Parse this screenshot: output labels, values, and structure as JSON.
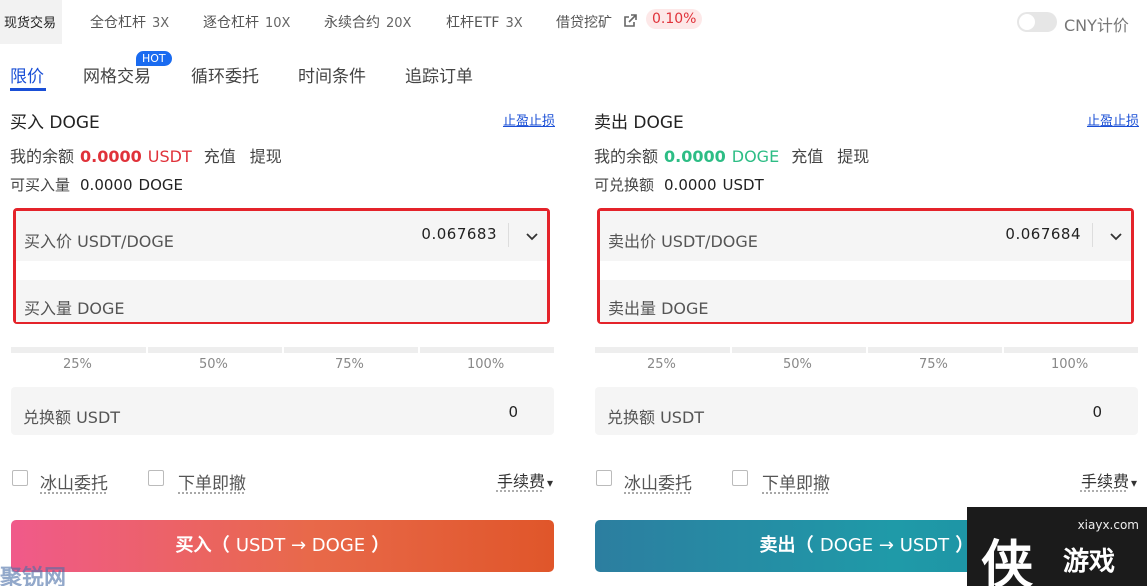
{
  "top_tabs": {
    "spot": "现货交易",
    "cross": "全仓杠杆",
    "cross_mult": "3X",
    "isolated": "逐仓杠杆",
    "isolated_mult": "10X",
    "perpetual": "永续合约",
    "perpetual_mult": "20X",
    "etf": "杠杆ETF",
    "etf_mult": "3X",
    "lending": "借贷挖矿",
    "lending_rate": "0.10%",
    "cny_label": "CNY计价"
  },
  "order_tabs": {
    "limit": "限价",
    "grid": "网格交易",
    "hot": "HOT",
    "loop": "循环委托",
    "time": "时间条件",
    "trailing": "追踪订单"
  },
  "buy": {
    "title": "买入 DOGE",
    "tpsl": "止盈止损",
    "balance_label": "我的余额",
    "balance_value": "0.0000",
    "balance_unit": "USDT",
    "deposit": "充值",
    "withdraw": "提现",
    "avail_label": "可买入量",
    "avail_value": "0.0000",
    "avail_unit": "DOGE",
    "price_label": "买入价 USDT/DOGE",
    "price_value": "0.067683",
    "amount_label": "买入量 DOGE",
    "pct": [
      "25%",
      "50%",
      "75%",
      "100%"
    ],
    "exchange_label": "兑换额 USDT",
    "exchange_value": "0",
    "iceberg": "冰山委托",
    "ioc": "下单即撤",
    "fee": "手续费",
    "action_main": "买入（",
    "action_pair": "USDT → DOGE",
    "action_end": "）"
  },
  "sell": {
    "title": "卖出 DOGE",
    "tpsl": "止盈止损",
    "balance_label": "我的余额",
    "balance_value": "0.0000",
    "balance_unit": "DOGE",
    "deposit": "充值",
    "withdraw": "提现",
    "avail_label": "可兑换额",
    "avail_value": "0.0000",
    "avail_unit": "USDT",
    "price_label": "卖出价 USDT/DOGE",
    "price_value": "0.067684",
    "amount_label": "卖出量 DOGE",
    "pct": [
      "25%",
      "50%",
      "75%",
      "100%"
    ],
    "exchange_label": "兑换额 USDT",
    "exchange_value": "0",
    "iceberg": "冰山委托",
    "ioc": "下单即撤",
    "fee": "手续费",
    "action_main": "卖出（",
    "action_pair": "DOGE → USDT",
    "action_end": "）"
  },
  "watermarks": {
    "left": "聚锐网",
    "site": "xiayx.com",
    "logo1": "侠",
    "logo2": "游戏"
  },
  "colors": {
    "accent_blue": "#1a4fd6",
    "buy_red": "#e0323a",
    "sell_green": "#2dbd85",
    "highlight_border": "#e4232a"
  }
}
